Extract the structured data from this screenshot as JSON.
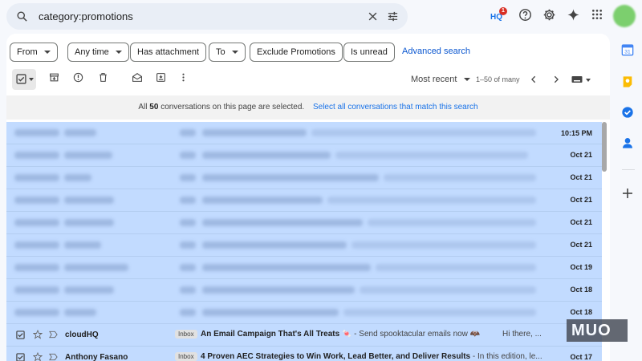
{
  "search": {
    "query": "category:promotions"
  },
  "filters": {
    "from_label": "From",
    "time_label": "Any time",
    "attachment_label": "Has attachment",
    "to_label": "To",
    "exclude_label": "Exclude Promotions",
    "unread_label": "Is unread",
    "advanced_label": "Advanced search"
  },
  "toolbar": {
    "sort_label": "Most recent",
    "range_label": "1–50 of many"
  },
  "banner": {
    "prefix": "All",
    "count": "50",
    "suffix": "conversations on this page are selected.",
    "link": "Select all conversations that match this search"
  },
  "emails": [
    {
      "date": "10:15 PM",
      "blurred": true
    },
    {
      "date": "Oct 21",
      "blurred": true
    },
    {
      "date": "Oct 21",
      "blurred": true
    },
    {
      "date": "Oct 21",
      "blurred": true
    },
    {
      "date": "Oct 21",
      "blurred": true
    },
    {
      "date": "Oct 21",
      "blurred": true
    },
    {
      "date": "Oct 19",
      "blurred": true
    },
    {
      "date": "Oct 18",
      "blurred": true
    },
    {
      "date": "Oct 18",
      "blurred": true
    },
    {
      "date": "",
      "blurred": false,
      "sender": "cloudHQ",
      "tag": "Inbox",
      "subject": "An Email Campaign That's All Treats 🍬",
      "snippet": " - Send spooktacular emails now 🦇",
      "extra": "Hi there, ..."
    },
    {
      "date": "Oct 17",
      "blurred": false,
      "sender": "Anthony Fasano",
      "tag": "Inbox",
      "subject": "4 Proven AEC Strategies to Win Work, Lead Better, and Deliver Results",
      "snippet": " - In this edition, le...",
      "extra": ""
    }
  ],
  "watermark": "MUO",
  "colors": {
    "selected_row": "#c2dbff",
    "accent": "#0b57d0"
  }
}
